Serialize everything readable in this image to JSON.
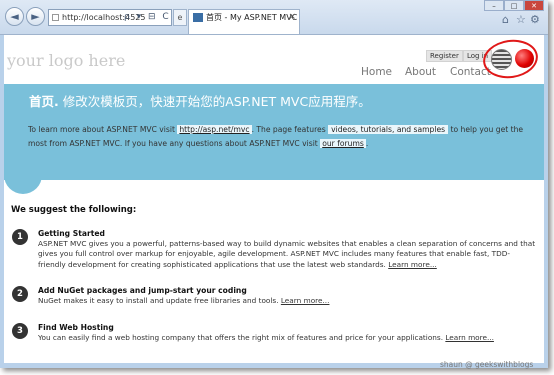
{
  "browser": {
    "address": "http://localhost:4525",
    "address_icons": "ρ ▾ ⊟ C ✕",
    "tab_title": "首页 - My ASP.NET MVC A...",
    "tab_close": "×",
    "back_glyph": "◄",
    "forward_glyph": "►",
    "icons": [
      "home-icon",
      "star-icon",
      "gear-icon"
    ],
    "window_buttons": [
      "–",
      "□",
      "✕"
    ]
  },
  "site": {
    "logo": "your logo here",
    "register": "Register",
    "login": "Log in",
    "menu": [
      "Home",
      "About",
      "Contact"
    ]
  },
  "hero": {
    "title_bold": "首页.",
    "title_rest": " 修改次模板页，快速开始您的ASP.NET MVC应用程序。",
    "p1": "To learn more about ASP.NET MVC visit",
    "link1": "http://asp.net/mvc",
    "p2": ". The page features",
    "highlight": "videos, tutorials, and samples",
    "p3": "to help you get the most from ASP.NET MVC. If you have any questions about ASP.NET MVC visit",
    "link2": "our forums",
    "p4": "."
  },
  "suggest_heading": "We suggest the following:",
  "items": [
    {
      "num": "1",
      "title": "Getting Started",
      "body": "ASP.NET MVC gives you a powerful, patterns-based way to build dynamic websites that enables a clean separation of concerns and that gives you full control over markup for enjoyable, agile development. ASP.NET MVC includes many features that enable fast, TDD-friendly development for creating sophisticated applications that use the latest web standards.",
      "link": "Learn more..."
    },
    {
      "num": "2",
      "title": "Add NuGet packages and jump-start your coding",
      "body": "NuGet makes it easy to install and update free libraries and tools.",
      "link": "Learn more..."
    },
    {
      "num": "3",
      "title": "Find Web Hosting",
      "body": "You can easily find a web hosting company that offers the right mix of features and price for your applications.",
      "link": "Learn more..."
    }
  ],
  "watermark": "shaun @ geekswithblogs",
  "colors": {
    "hero": "#7ac0da",
    "annotation": "#e01818",
    "language_red": "#e00000"
  }
}
